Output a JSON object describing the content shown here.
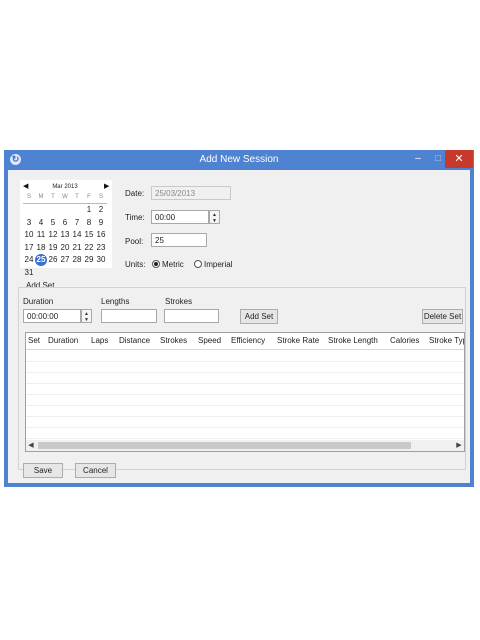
{
  "window": {
    "title": "Add New Session",
    "minimize": "–",
    "maximize": "□",
    "close": "✕",
    "app_icon": "↻"
  },
  "calendar": {
    "prev": "◀",
    "next": "▶",
    "month": "Mar 2013",
    "dows": [
      "S",
      "M",
      "T",
      "W",
      "T",
      "F",
      "S"
    ],
    "days": [
      "1",
      "2",
      "3",
      "4",
      "5",
      "6",
      "7",
      "8",
      "9",
      "10",
      "11",
      "12",
      "13",
      "14",
      "15",
      "16",
      "17",
      "18",
      "19",
      "20",
      "21",
      "22",
      "23",
      "24",
      "25",
      "26",
      "27",
      "28",
      "29",
      "30",
      "31"
    ],
    "selected": "25"
  },
  "form": {
    "date_label": "Date:",
    "date_value": "25/03/2013",
    "time_label": "Time:",
    "time_value": "00:00",
    "pool_label": "Pool:",
    "pool_value": "25",
    "units_label": "Units:",
    "metric_label": "Metric",
    "imperial_label": "Imperial"
  },
  "add_set": {
    "group_label": "Add Set",
    "duration_label": "Duration",
    "duration_value": "00:00:00",
    "lengths_label": "Lengths",
    "lengths_value": "",
    "strokes_label": "Strokes",
    "strokes_value": "",
    "add_button": "Add Set",
    "delete_button": "Delete Set"
  },
  "spin": {
    "up": "▲",
    "down": "▼"
  },
  "table": {
    "columns": [
      "Set",
      "Duration",
      "Laps",
      "Distance",
      "Strokes",
      "Speed",
      "Efficiency",
      "Stroke Rate",
      "Stroke Length",
      "Calories",
      "Stroke Typ"
    ]
  },
  "scrollbar": {
    "left": "◀",
    "right": "▶"
  },
  "footer": {
    "save": "Save",
    "cancel": "Cancel"
  }
}
